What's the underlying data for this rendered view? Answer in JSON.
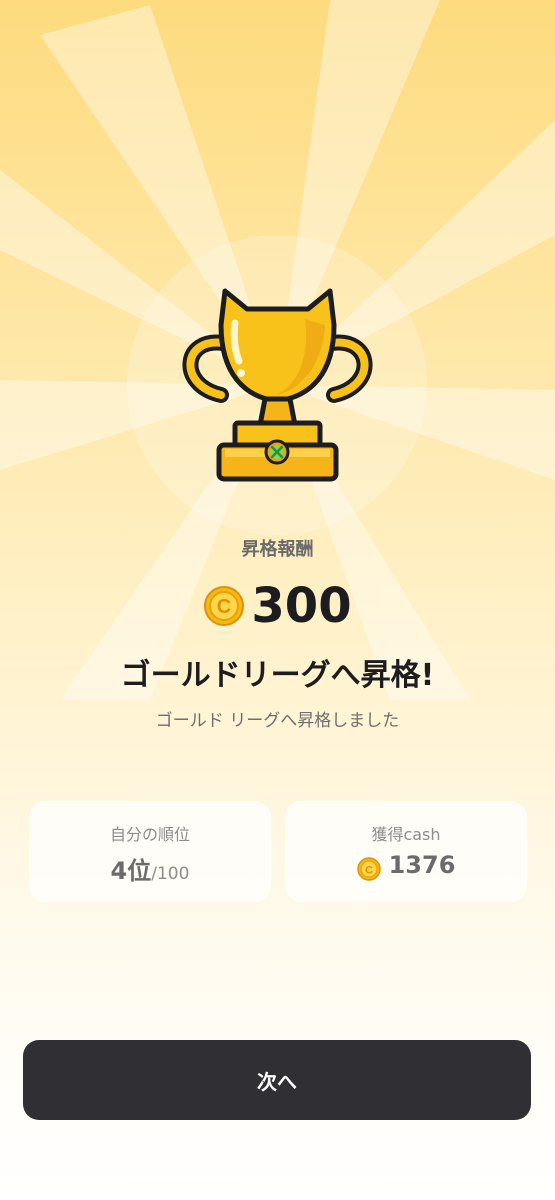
{
  "reward": {
    "label": "昇格報酬",
    "icon": "coin-icon",
    "amount": "300"
  },
  "headline": "ゴールドリーグへ昇格!",
  "subline": "ゴールド リーグへ昇格しました",
  "stats": {
    "rank": {
      "title": "自分の順位",
      "value": "4位",
      "total": "/100"
    },
    "cash": {
      "title": "獲得cash",
      "icon": "coin-icon",
      "value": "1376"
    }
  },
  "next_button": "次へ",
  "colors": {
    "background_top": "#fddb7e",
    "trophy_gold": "#f9c21b",
    "button_dark": "#303034",
    "text_dark": "#1d1d1f"
  }
}
